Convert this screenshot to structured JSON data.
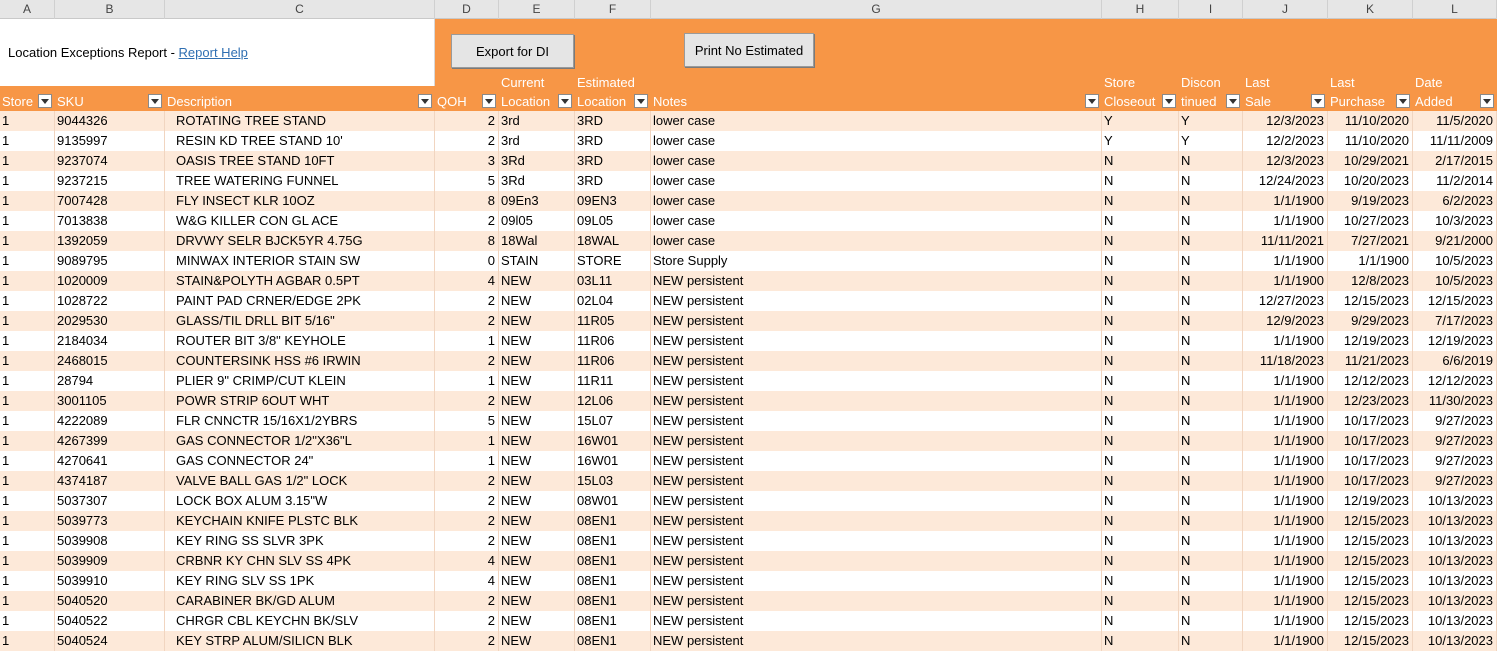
{
  "column_letters": [
    "A",
    "B",
    "C",
    "D",
    "E",
    "F",
    "G",
    "H",
    "I",
    "J",
    "K",
    "L"
  ],
  "report": {
    "title": "Location Exceptions Report - ",
    "help_link": "Report Help"
  },
  "buttons": {
    "export": "Export for DI",
    "print": "Print No Estimated"
  },
  "headers": {
    "store": "Store",
    "sku": "SKU",
    "description": "Description",
    "qoh": "QOH",
    "current_1": "Current",
    "current_2": "Location",
    "estimated_1": "Estimated",
    "estimated_2": "Location",
    "notes": "Notes",
    "closeout_1": "Store",
    "closeout_2": "Closeout",
    "discon_1": "Discon",
    "discon_2": "tinued",
    "lastsale_1": "Last",
    "lastsale_2": "Sale",
    "lastpurchase_1": "Last",
    "lastpurchase_2": "Purchase",
    "dateadded_1": "Date",
    "dateadded_2": "Added"
  },
  "rows": [
    [
      "1",
      "9044326",
      "ROTATING TREE STAND",
      "2",
      "3rd",
      "3RD",
      "lower case",
      "Y",
      "Y",
      "12/3/2023",
      "11/10/2020",
      "11/5/2020"
    ],
    [
      "1",
      "9135997",
      "RESIN KD TREE STAND 10'",
      "2",
      "3rd",
      "3RD",
      "lower case",
      "Y",
      "Y",
      "12/2/2023",
      "11/10/2020",
      "11/11/2009"
    ],
    [
      "1",
      "9237074",
      "OASIS TREE STAND 10FT",
      "3",
      "3Rd",
      "3RD",
      "lower case",
      "N",
      "N",
      "12/3/2023",
      "10/29/2021",
      "2/17/2015"
    ],
    [
      "1",
      "9237215",
      "TREE WATERING FUNNEL",
      "5",
      "3Rd",
      "3RD",
      "lower case",
      "N",
      "N",
      "12/24/2023",
      "10/20/2023",
      "11/2/2014"
    ],
    [
      "1",
      "7007428",
      "FLY INSECT KLR 10OZ",
      "8",
      "09En3",
      "09EN3",
      "lower case",
      "N",
      "N",
      "1/1/1900",
      "9/19/2023",
      "6/2/2023"
    ],
    [
      "1",
      "7013838",
      "W&G KILLER CON GL ACE",
      "2",
      "09l05",
      "09L05",
      "lower case",
      "N",
      "N",
      "1/1/1900",
      "10/27/2023",
      "10/3/2023"
    ],
    [
      "1",
      "1392059",
      "DRVWY SELR BJCK5YR 4.75G",
      "8",
      "18Wal",
      "18WAL",
      "lower case",
      "N",
      "N",
      "11/11/2021",
      "7/27/2021",
      "9/21/2000"
    ],
    [
      "1",
      "9089795",
      "MINWAX INTERIOR STAIN SW",
      "0",
      "STAIN",
      "STORE",
      "Store Supply",
      "N",
      "N",
      "1/1/1900",
      "1/1/1900",
      "10/5/2023"
    ],
    [
      "1",
      "1020009",
      "STAIN&POLYTH AGBAR 0.5PT",
      "4",
      "NEW",
      "03L11",
      "NEW persistent",
      "N",
      "N",
      "1/1/1900",
      "12/8/2023",
      "10/5/2023"
    ],
    [
      "1",
      "1028722",
      "PAINT PAD CRNER/EDGE 2PK",
      "2",
      "NEW",
      "02L04",
      "NEW persistent",
      "N",
      "N",
      "12/27/2023",
      "12/15/2023",
      "12/15/2023"
    ],
    [
      "1",
      "2029530",
      "GLASS/TIL DRLL BIT 5/16\"",
      "2",
      "NEW",
      "11R05",
      "NEW persistent",
      "N",
      "N",
      "12/9/2023",
      "9/29/2023",
      "7/17/2023"
    ],
    [
      "1",
      "2184034",
      "ROUTER BIT 3/8\" KEYHOLE",
      "1",
      "NEW",
      "11R06",
      "NEW persistent",
      "N",
      "N",
      "1/1/1900",
      "12/19/2023",
      "12/19/2023"
    ],
    [
      "1",
      "2468015",
      "COUNTERSINK HSS #6 IRWIN",
      "2",
      "NEW",
      "11R06",
      "NEW persistent",
      "N",
      "N",
      "11/18/2023",
      "11/21/2023",
      "6/6/2019"
    ],
    [
      "1",
      "28794",
      "PLIER 9\" CRIMP/CUT KLEIN",
      "1",
      "NEW",
      "11R11",
      "NEW persistent",
      "N",
      "N",
      "1/1/1900",
      "12/12/2023",
      "12/12/2023"
    ],
    [
      "1",
      "3001105",
      "POWR STRIP 6OUT WHT",
      "2",
      "NEW",
      "12L06",
      "NEW persistent",
      "N",
      "N",
      "1/1/1900",
      "12/23/2023",
      "11/30/2023"
    ],
    [
      "1",
      "4222089",
      "FLR CNNCTR 15/16X1/2YBRS",
      "5",
      "NEW",
      "15L07",
      "NEW persistent",
      "N",
      "N",
      "1/1/1900",
      "10/17/2023",
      "9/27/2023"
    ],
    [
      "1",
      "4267399",
      "GAS CONNECTOR 1/2\"X36\"L",
      "1",
      "NEW",
      "16W01",
      "NEW persistent",
      "N",
      "N",
      "1/1/1900",
      "10/17/2023",
      "9/27/2023"
    ],
    [
      "1",
      "4270641",
      "GAS CONNECTOR 24\"",
      "1",
      "NEW",
      "16W01",
      "NEW persistent",
      "N",
      "N",
      "1/1/1900",
      "10/17/2023",
      "9/27/2023"
    ],
    [
      "1",
      "4374187",
      "VALVE BALL GAS 1/2\" LOCK",
      "2",
      "NEW",
      "15L03",
      "NEW persistent",
      "N",
      "N",
      "1/1/1900",
      "10/17/2023",
      "9/27/2023"
    ],
    [
      "1",
      "5037307",
      "LOCK BOX ALUM 3.15\"W",
      "2",
      "NEW",
      "08W01",
      "NEW persistent",
      "N",
      "N",
      "1/1/1900",
      "12/19/2023",
      "10/13/2023"
    ],
    [
      "1",
      "5039773",
      "KEYCHAIN KNIFE PLSTC BLK",
      "2",
      "NEW",
      "08EN1",
      "NEW persistent",
      "N",
      "N",
      "1/1/1900",
      "12/15/2023",
      "10/13/2023"
    ],
    [
      "1",
      "5039908",
      "KEY RING SS SLVR 3PK",
      "2",
      "NEW",
      "08EN1",
      "NEW persistent",
      "N",
      "N",
      "1/1/1900",
      "12/15/2023",
      "10/13/2023"
    ],
    [
      "1",
      "5039909",
      "CRBNR KY CHN SLV SS 4PK",
      "4",
      "NEW",
      "08EN1",
      "NEW persistent",
      "N",
      "N",
      "1/1/1900",
      "12/15/2023",
      "10/13/2023"
    ],
    [
      "1",
      "5039910",
      "KEY RING SLV SS 1PK",
      "4",
      "NEW",
      "08EN1",
      "NEW persistent",
      "N",
      "N",
      "1/1/1900",
      "12/15/2023",
      "10/13/2023"
    ],
    [
      "1",
      "5040520",
      "CARABINER BK/GD ALUM",
      "2",
      "NEW",
      "08EN1",
      "NEW persistent",
      "N",
      "N",
      "1/1/1900",
      "12/15/2023",
      "10/13/2023"
    ],
    [
      "1",
      "5040522",
      "CHRGR CBL KEYCHN BK/SLV",
      "2",
      "NEW",
      "08EN1",
      "NEW persistent",
      "N",
      "N",
      "1/1/1900",
      "12/15/2023",
      "10/13/2023"
    ],
    [
      "1",
      "5040524",
      "KEY STRP ALUM/SILICN BLK",
      "2",
      "NEW",
      "08EN1",
      "NEW persistent",
      "N",
      "N",
      "1/1/1900",
      "12/15/2023",
      "10/13/2023"
    ]
  ],
  "colors": {
    "header_orange": "#f79646",
    "band_light": "#fde9d9"
  }
}
